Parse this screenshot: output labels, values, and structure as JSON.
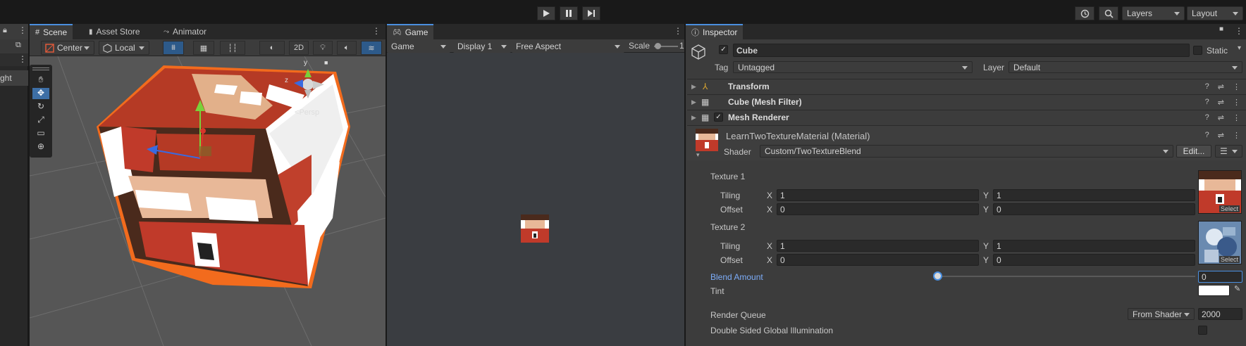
{
  "main_toolbar": {
    "layers_label": "Layers",
    "layout_label": "Layout"
  },
  "scene_panel": {
    "tabs": [
      {
        "label": "Scene",
        "active": true
      },
      {
        "label": "Asset Store",
        "active": false
      },
      {
        "label": "Animator",
        "active": false
      }
    ],
    "pivot_label": "Center",
    "space_label": "Local",
    "mode_2d": "2D",
    "gizmo_label": "Persp",
    "hierarchy_partial": "ght"
  },
  "game_panel": {
    "tab_label": "Game",
    "view_dropdown": "Game",
    "display_dropdown": "Display 1",
    "aspect_dropdown": "Free Aspect",
    "scale_label": "Scale",
    "scale_value": "1"
  },
  "inspector": {
    "tab_label": "Inspector",
    "object_name": "Cube",
    "static_label": "Static",
    "tag_label": "Tag",
    "tag_value": "Untagged",
    "layer_label": "Layer",
    "layer_value": "Default",
    "components": [
      {
        "name": "Transform"
      },
      {
        "name": "Cube (Mesh Filter)"
      },
      {
        "name": "Mesh Renderer"
      }
    ],
    "material": {
      "name": "LearnTwoTextureMaterial (Material)",
      "shader_label": "Shader",
      "shader_value": "Custom/TwoTextureBlend",
      "edit_label": "Edit..."
    },
    "texture1": {
      "label": "Texture 1",
      "tiling_label": "Tiling",
      "offset_label": "Offset",
      "tiling_x": "1",
      "tiling_y": "1",
      "offset_x": "0",
      "offset_y": "0",
      "select_label": "Select"
    },
    "texture2": {
      "label": "Texture 2",
      "tiling_label": "Tiling",
      "offset_label": "Offset",
      "tiling_x": "1",
      "tiling_y": "1",
      "offset_x": "0",
      "offset_y": "0",
      "select_label": "Select"
    },
    "x_label": "X",
    "y_label": "Y",
    "blend_amount_label": "Blend Amount",
    "blend_amount_value": "0",
    "tint_label": "Tint",
    "render_queue_label": "Render Queue",
    "render_queue_source": "From Shader",
    "render_queue_value": "2000",
    "dsgi_label": "Double Sided Global Illumination"
  },
  "colors": {
    "accent": "#4a8fe0",
    "panel": "#3c3c3c",
    "selection_outline": "#f26b1d"
  }
}
